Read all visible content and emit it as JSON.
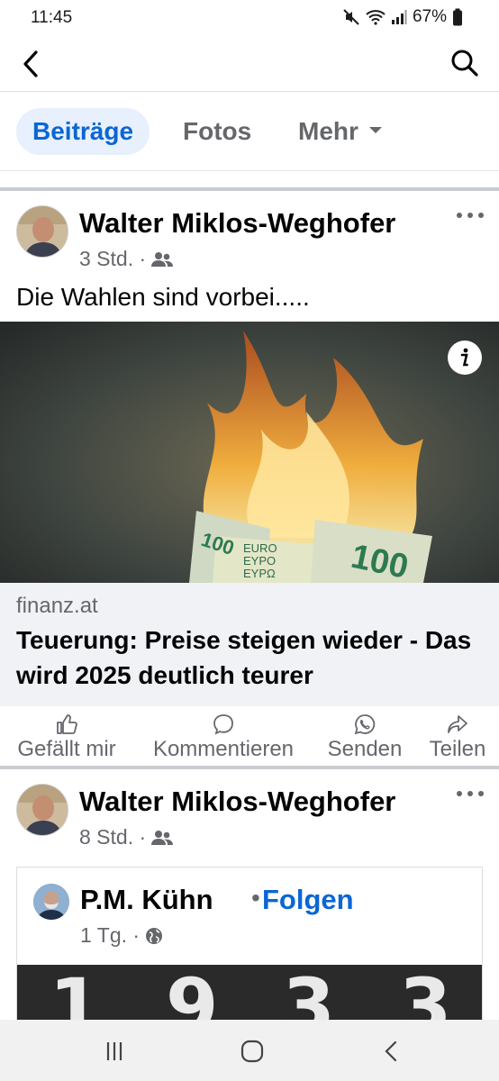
{
  "status": {
    "time": "11:45",
    "battery": "67%"
  },
  "tabs": [
    {
      "label": "Beiträge",
      "active": true
    },
    {
      "label": "Fotos"
    },
    {
      "label": "Mehr"
    }
  ],
  "posts": [
    {
      "author": "Walter Miklos-Weghofer",
      "time": "3 Std. ·",
      "audience_icon": "friends-icon",
      "text": "Die Wahlen sind vorbei.....",
      "link": {
        "domain": "finanz.at",
        "title": "Teuerung: Preise steigen wieder - Das wird 2025 deutlich teurer",
        "image": "burning-euro-banknotes",
        "banknote_text": [
          "100",
          "100",
          "EURO",
          "EYPO",
          "ΕΥΡΩ"
        ]
      }
    },
    {
      "author": "Walter Miklos-Weghofer",
      "time": "8 Std. ·",
      "audience_icon": "friends-icon",
      "shared": {
        "author": "P.M. Kühn",
        "separator": "•",
        "follow": "Folgen",
        "time": "1 Tg. ·",
        "audience_icon": "globe-icon",
        "image_digits": [
          "1",
          "9",
          "3",
          "3"
        ]
      }
    }
  ],
  "actions": [
    {
      "label": "Gefällt mir",
      "icon": "like-icon"
    },
    {
      "label": "Kommentieren",
      "icon": "comment-icon"
    },
    {
      "label": "Senden",
      "icon": "whatsapp-icon"
    },
    {
      "label": "Teilen",
      "icon": "share-icon"
    }
  ],
  "colors": {
    "accent": "#0a66d4",
    "secondary_text": "#65676b",
    "link_bg": "#f0f2f5"
  }
}
